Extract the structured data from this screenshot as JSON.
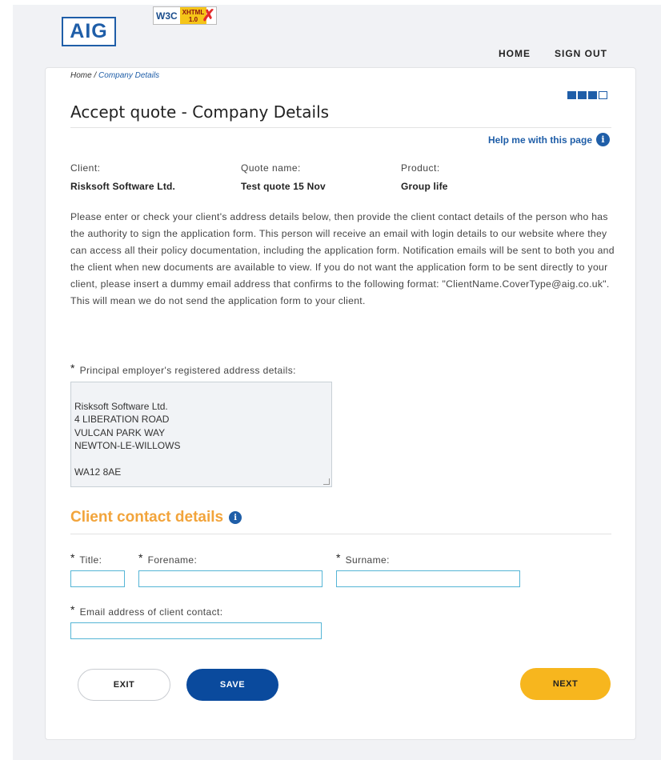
{
  "header": {
    "logo_text": "AIG",
    "badge_w3c": "W3C",
    "badge_xhtml_top": "XHTML",
    "badge_xhtml_bottom": "1.0",
    "nav": {
      "home": "HOME",
      "sign_out": "SIGN OUT"
    }
  },
  "breadcrumb": {
    "home": "Home",
    "separator": " / ",
    "current": "Company Details"
  },
  "progress": {
    "total_steps": 4,
    "completed_steps": 3
  },
  "page": {
    "title": "Accept quote - Company Details",
    "help_link": "Help me with this page"
  },
  "quote_info": {
    "client_label": "Client:",
    "client_value": "Risksoft Software Ltd.",
    "quote_label": "Quote name:",
    "quote_value": "Test quote 15 Nov",
    "product_label": "Product:",
    "product_value": "Group life"
  },
  "intro_text": "Please enter or check your client's address details below, then provide the client contact details of the person who has the authority to sign the application form. This person will receive an email with login details to our website where they can access all their policy documentation, including the application form. Notification emails will be sent to both you and the client when new documents are available to view. If you do not want the application form to be sent directly to your client, please insert a dummy email address that confirms to the following format: \"ClientName.CoverType@aig.co.uk\". This will mean we do not send the application form to your client.",
  "address": {
    "required_mark": "*",
    "label": "Principal employer's registered address details:",
    "value": "Risksoft Software Ltd.\n4 LIBERATION ROAD\nVULCAN PARK WAY\nNEWTON-LE-WILLOWS\n\nWA12 8AE"
  },
  "contact": {
    "section_title": "Client contact details",
    "required_mark": "*",
    "title_label": "Title:",
    "title_value": "",
    "forename_label": "Forename:",
    "forename_value": "",
    "surname_label": "Surname:",
    "surname_value": "",
    "email_label": "Email address of client contact:",
    "email_value": ""
  },
  "buttons": {
    "exit": "EXIT",
    "save": "SAVE",
    "next": "NEXT"
  },
  "colors": {
    "brand_blue": "#1f5ea8",
    "save_blue": "#0a4a9d",
    "accent_orange": "#f2a43b",
    "next_yellow": "#f7b61e",
    "input_border": "#55b5d6"
  }
}
